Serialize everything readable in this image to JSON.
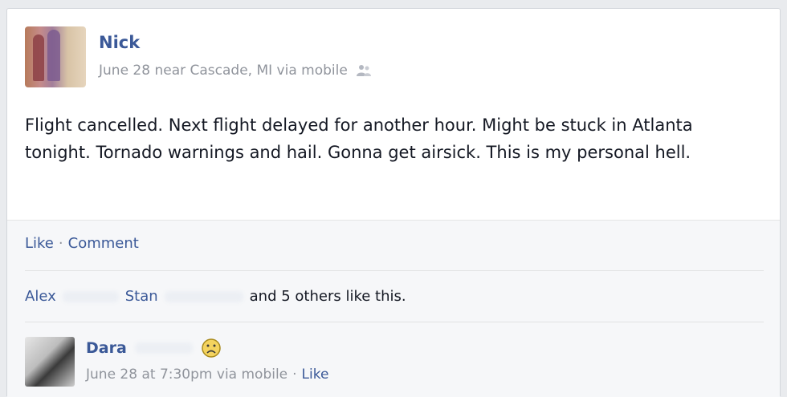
{
  "post": {
    "author": "Nick",
    "meta": "June 28 near Cascade, MI via mobile",
    "privacy_icon": "friends-icon",
    "text": "Flight cancelled. Next flight delayed for another hour. Might be stuck in Atlanta tonight. Tornado warnings and hail. Gonna get airsick. This is my personal hell."
  },
  "actions": {
    "like_label": "Like",
    "separator": "·",
    "comment_label": "Comment"
  },
  "likes": {
    "first_liker": "Alex",
    "second_liker": "Stan",
    "suffix": "and 5 others like this."
  },
  "comment": {
    "author": "Dara",
    "emoticon": "sad-face-icon",
    "meta": "June 28 at 7:30pm via mobile",
    "separator": "·",
    "like_label": "Like"
  },
  "colors": {
    "link": "#3b5998",
    "muted": "#90949c",
    "text": "#141823"
  }
}
